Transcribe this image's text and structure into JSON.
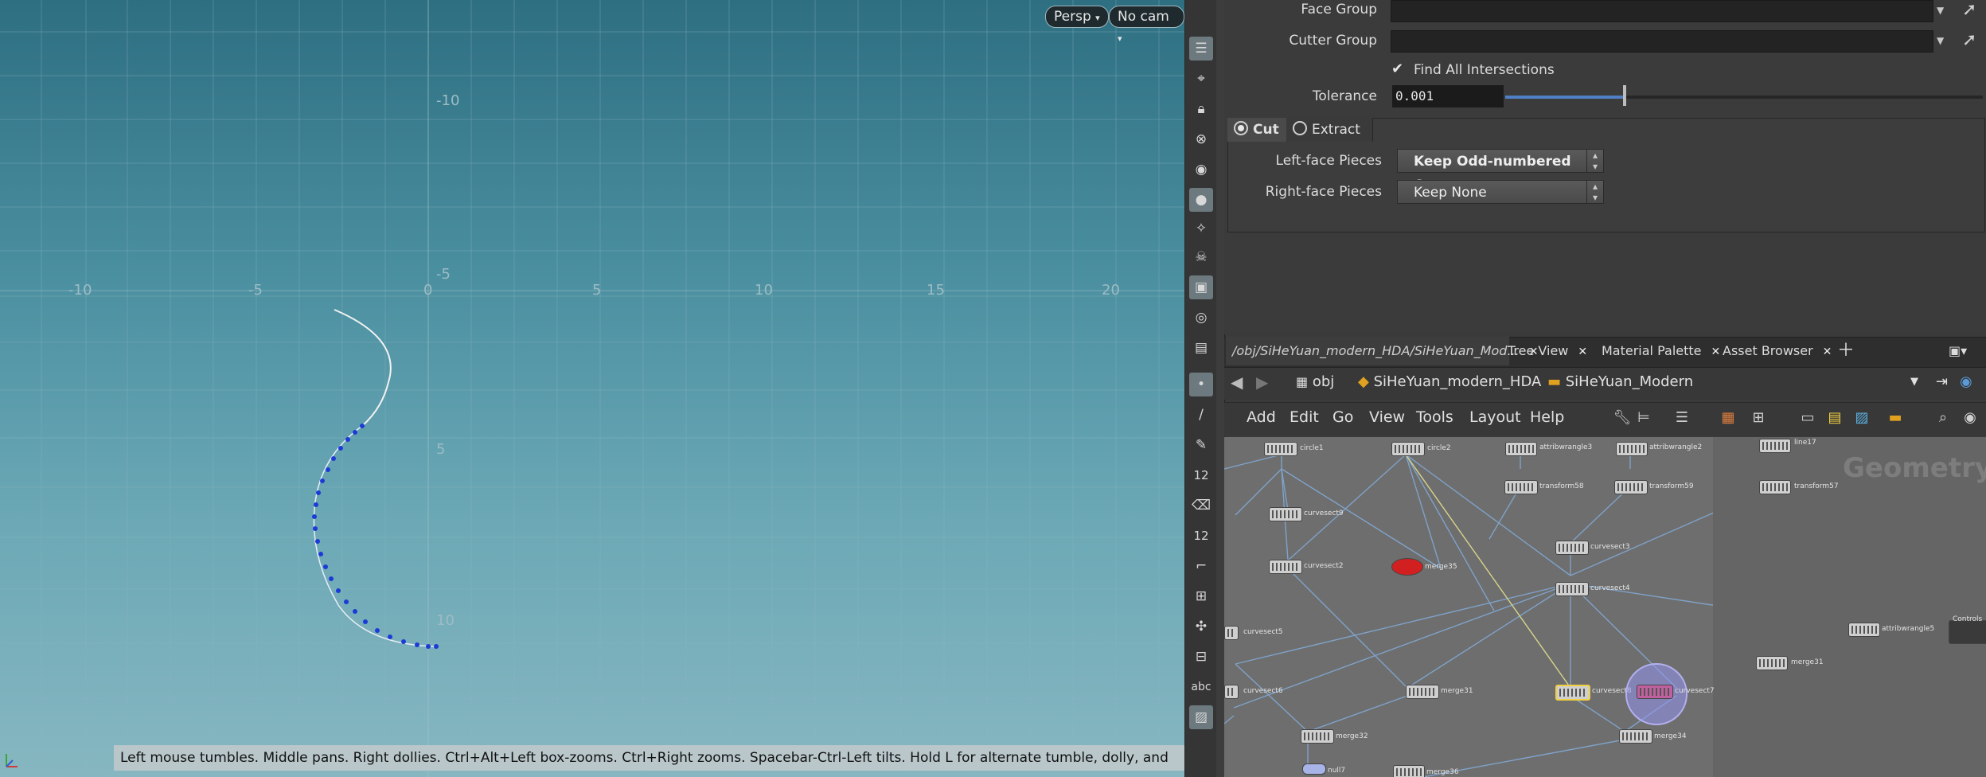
{
  "viewport": {
    "persp_label": "Persp",
    "cam_label": "No cam",
    "hint": "Left mouse tumbles. Middle pans. Right dollies. Ctrl+Alt+Left box-zooms. Ctrl+Right zooms. Spacebar-Ctrl-Left tilts. Hold L for alternate tumble, dolly, and zoom.",
    "grid_labels": {
      "x": [
        "-10",
        "-5",
        "0",
        "5",
        "10",
        "15",
        "20"
      ],
      "y": [
        "-10",
        "-5",
        "5",
        "10"
      ]
    }
  },
  "toolbar": {
    "icons": [
      "wireframe-ghost-icon",
      "snap-icon",
      "lock-icon",
      "delete-icon",
      "shading-icon",
      "light-icon",
      "headlight-icon",
      "skull-light-icon",
      "camera-icon",
      "eye-icon",
      "camera-view-icon",
      "point-display-icon",
      "brush-icon",
      "pen-icon",
      "number-icon",
      "eraser-icon",
      "number-icon-2",
      "curve-icon",
      "scale-icon",
      "transform-icon",
      "display-icon"
    ],
    "number_label": "12",
    "abc_label": "abc"
  },
  "params": {
    "face_group_label": "Face Group",
    "cutter_group_label": "Cutter Group",
    "find_all_label": "Find All Intersections",
    "find_all_checked": true,
    "tolerance_label": "Tolerance",
    "tolerance_value": "0.001",
    "tolerance_fraction": 0.25,
    "tabs": [
      {
        "label": "Cut",
        "selected": true
      },
      {
        "label": "Extract",
        "selected": false
      }
    ],
    "left_pieces_label": "Left-face Pieces",
    "left_pieces_value": "Keep Odd-numbered Ones",
    "right_pieces_label": "Right-face Pieces",
    "right_pieces_value": "Keep None"
  },
  "pane_tabs": [
    {
      "label": "/obj/SiHeYuan_modern_HDA/SiHeYuan_Mod...",
      "active": true
    },
    {
      "label": "Tree View",
      "active": false
    },
    {
      "label": "Material Palette",
      "active": false
    },
    {
      "label": "Asset Browser",
      "active": false
    }
  ],
  "pathbar": {
    "root": "obj",
    "hda": "SiHeYuan_modern_HDA",
    "subnet": "SiHeYuan_Modern"
  },
  "net_menu": [
    "Add",
    "Edit",
    "Go",
    "View",
    "Tools",
    "Layout",
    "Help"
  ],
  "network": {
    "context_label": "Geometry",
    "nodes": [
      "circle1",
      "circle2",
      "attribwrangle3",
      "attribwrangle2",
      "line17",
      "transform58",
      "transform59",
      "transform57",
      "curvesect9",
      "curvesect3",
      "curvesect2",
      "merge35",
      "curvesect4",
      "curvesect5",
      "attribwrangle5",
      "Controls",
      "curvesect6",
      "merge31",
      "curvesect8",
      "curvesect7",
      "merge31",
      "merge32",
      "merge34",
      "null7",
      "merge36"
    ]
  }
}
